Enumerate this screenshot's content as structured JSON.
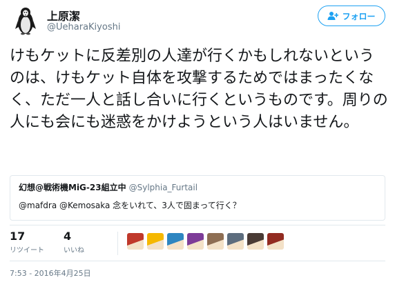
{
  "author": {
    "name": "上原潔",
    "handle": "@UeharaKiyoshi"
  },
  "follow_button": {
    "label": "フォロー"
  },
  "tweet": {
    "text": "けもケットに反差別の人達が行くかもしれないというのは、けもケット自体を攻撃するためではまったくなく、ただ一人と話し合いに行くというものです。周りの人にも会にも迷惑をかけようという人はいません。"
  },
  "quoted_tweet": {
    "name": "幻想@戦術機MiG-23組立中",
    "handle": "@Sylphia_Furtail",
    "text": "@mafdra @Kemosaka 念をいれて、3人で固まって行く？"
  },
  "stats": {
    "retweets": {
      "count": "17",
      "label": "リツイート"
    },
    "likes": {
      "count": "4",
      "label": "いいね"
    }
  },
  "liker_avatars": [
    {
      "name": "liker-avatar-1",
      "color": "#c0392b"
    },
    {
      "name": "liker-avatar-2",
      "color": "#f5b800"
    },
    {
      "name": "liker-avatar-3",
      "color": "#2e86c1"
    },
    {
      "name": "liker-avatar-4",
      "color": "#7d3c98"
    },
    {
      "name": "liker-avatar-5",
      "color": "#8e6e53"
    },
    {
      "name": "liker-avatar-6",
      "color": "#5d6d7e"
    },
    {
      "name": "liker-avatar-7",
      "color": "#4a3b35"
    },
    {
      "name": "liker-avatar-8",
      "color": "#922b21"
    }
  ],
  "timestamp": "7:53 - 2016年4月25日",
  "colors": {
    "accent": "#1da1f2",
    "text": "#14171a",
    "secondary": "#657786",
    "border": "#e1e8ed"
  }
}
